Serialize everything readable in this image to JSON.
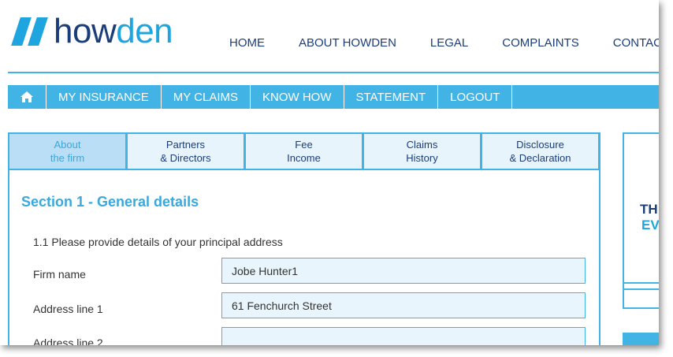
{
  "logo": {
    "part1": "how",
    "part2": "den"
  },
  "topnav": [
    "HOME",
    "ABOUT HOWDEN",
    "LEGAL",
    "COMPLAINTS",
    "CONTACT"
  ],
  "menubar": {
    "home_icon": "home-icon",
    "items": [
      "MY INSURANCE",
      "MY CLAIMS",
      "KNOW HOW",
      "STATEMENT",
      "LOGOUT"
    ]
  },
  "tabs": [
    {
      "line1": "About",
      "line2": "the firm",
      "active": true
    },
    {
      "line1": "Partners",
      "line2": "& Directors"
    },
    {
      "line1": "Fee",
      "line2": "Income"
    },
    {
      "line1": "Claims",
      "line2": "History"
    },
    {
      "line1": "Disclosure",
      "line2": "& Declaration"
    }
  ],
  "form": {
    "section_title": "Section 1 - General details",
    "subtitle": "1.1 Please provide details of your principal address",
    "fields": [
      {
        "label": "Firm name",
        "value": "Jobe Hunter1"
      },
      {
        "label": "Address line 1",
        "value": "61 Fenchurch Street"
      },
      {
        "label": "Address line 2",
        "value": ""
      }
    ]
  },
  "side": {
    "line1": "TH",
    "line2": "EV"
  },
  "colors": {
    "brand_dark": "#1b3d7a",
    "brand_light": "#1ea5e0",
    "bar": "#41b4e5",
    "field_bg": "#e9f5fc"
  }
}
